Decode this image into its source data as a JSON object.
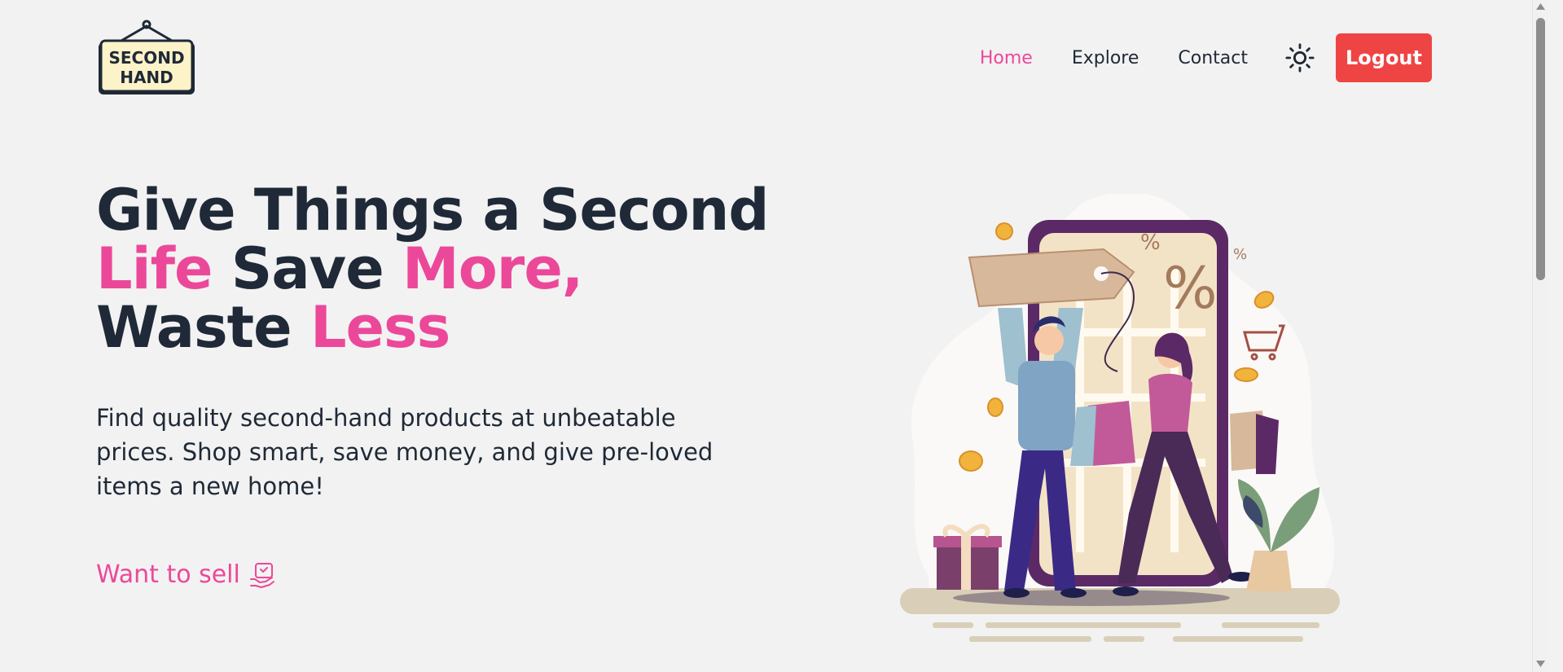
{
  "header": {
    "logo_text_line1": "SECOND",
    "logo_text_line2": "HAND",
    "nav": [
      {
        "label": "Home",
        "active": true
      },
      {
        "label": "Explore",
        "active": false
      },
      {
        "label": "Contact",
        "active": false
      }
    ],
    "theme_icon": "sun-icon",
    "logout_label": "Logout"
  },
  "hero": {
    "title_part1": "Give Things a Second",
    "title_part2": "Life",
    "title_part3": "Save",
    "title_part4": "More,",
    "title_part5": "Waste",
    "title_part6": "Less",
    "description": "Find quality second-hand products at unbeatable prices. Shop smart, save money, and give pre-loved items a new home!",
    "sell_label": "Want to sell",
    "sell_icon": "hand-heart-icon"
  },
  "illustration": {
    "percent_big": "%",
    "percent_small": "%"
  },
  "colors": {
    "accent": "#ec4899",
    "danger": "#ef4444",
    "text": "#1f2937",
    "background": "#f2f2f2"
  }
}
